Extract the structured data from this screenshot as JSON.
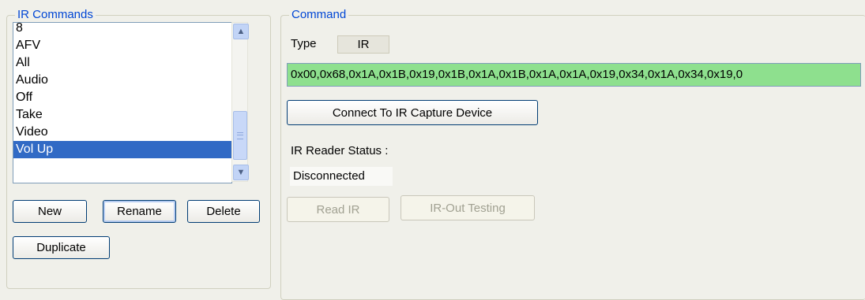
{
  "ir_commands": {
    "group_title": "IR Commands",
    "items": [
      {
        "label": "8"
      },
      {
        "label": "AFV"
      },
      {
        "label": "All"
      },
      {
        "label": "Audio"
      },
      {
        "label": "Off"
      },
      {
        "label": "Take"
      },
      {
        "label": "Video"
      },
      {
        "label": "Vol Up"
      }
    ],
    "selected_item": "Vol Up",
    "buttons": {
      "new": "New",
      "rename": "Rename",
      "delete": "Delete",
      "duplicate": "Duplicate"
    }
  },
  "command": {
    "group_title": "Command",
    "type_label": "Type",
    "type_value": "IR",
    "hex_value": "0x00,0x68,0x1A,0x1B,0x19,0x1B,0x1A,0x1B,0x1A,0x1A,0x19,0x34,0x1A,0x34,0x19,0",
    "hex_field_color": "#8ee08e",
    "connect_button": "Connect To IR Capture Device",
    "reader_status_label": "IR Reader Status :",
    "reader_status_value": "Disconnected",
    "read_ir_button": "Read IR",
    "ir_out_testing_button": "IR-Out Testing"
  },
  "colors": {
    "group_title": "#0046d5",
    "selection": "#316ac5",
    "background": "#f0f0ea"
  }
}
